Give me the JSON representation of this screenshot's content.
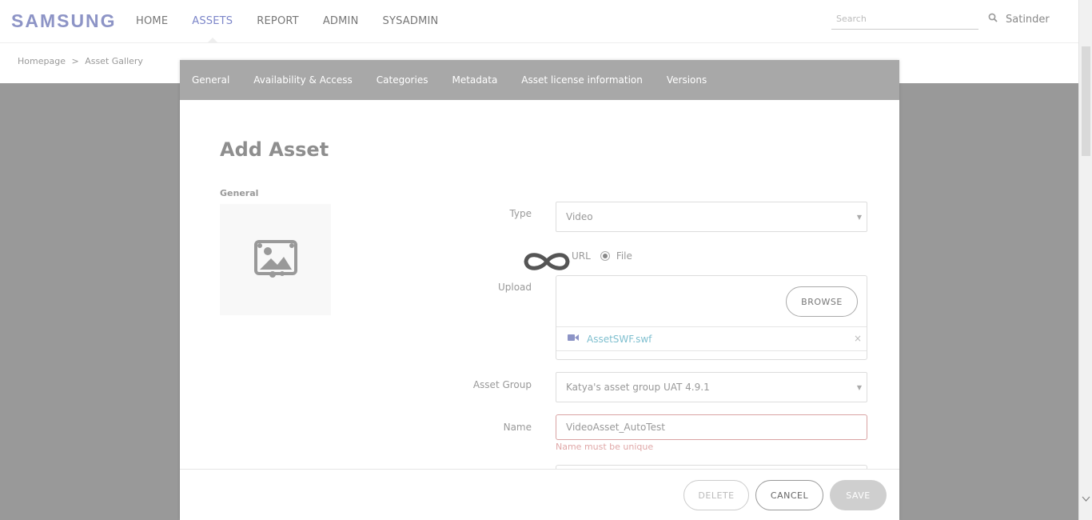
{
  "header": {
    "logo": "SAMSUNG",
    "nav": [
      "HOME",
      "ASSETS",
      "REPORT",
      "ADMIN",
      "SYSADMIN"
    ],
    "active_nav": "ASSETS",
    "search_placeholder": "Search",
    "user": "Satinder"
  },
  "breadcrumb": {
    "home": "Homepage",
    "separator": ">",
    "current": "Asset Gallery"
  },
  "modal": {
    "tabs": [
      "General",
      "Availability & Access",
      "Categories",
      "Metadata",
      "Asset license information",
      "Versions"
    ],
    "title": "Add Asset",
    "section": "General",
    "fields": {
      "type_label": "Type",
      "type_value": "Video",
      "url_option": "URL",
      "file_option": "File",
      "selected_source": "File",
      "upload_label": "Upload",
      "browse_label": "BROWSE",
      "file_name": "AssetSWF.swf",
      "file_remove": "×",
      "asset_group_label": "Asset Group",
      "asset_group_value": "Katya's asset group UAT 4.9.1",
      "name_label": "Name",
      "name_value": "VideoAsset_AutoTest",
      "name_error": "Name must be unique"
    },
    "footer": {
      "delete": "DELETE",
      "cancel": "CANCEL",
      "save": "SAVE"
    }
  },
  "colors": {
    "accent": "#7c86c9",
    "overlay": "#999999",
    "tab_bar": "#a8a8a8",
    "error": "#e0a8a8",
    "file_link": "#7fbfcf"
  }
}
